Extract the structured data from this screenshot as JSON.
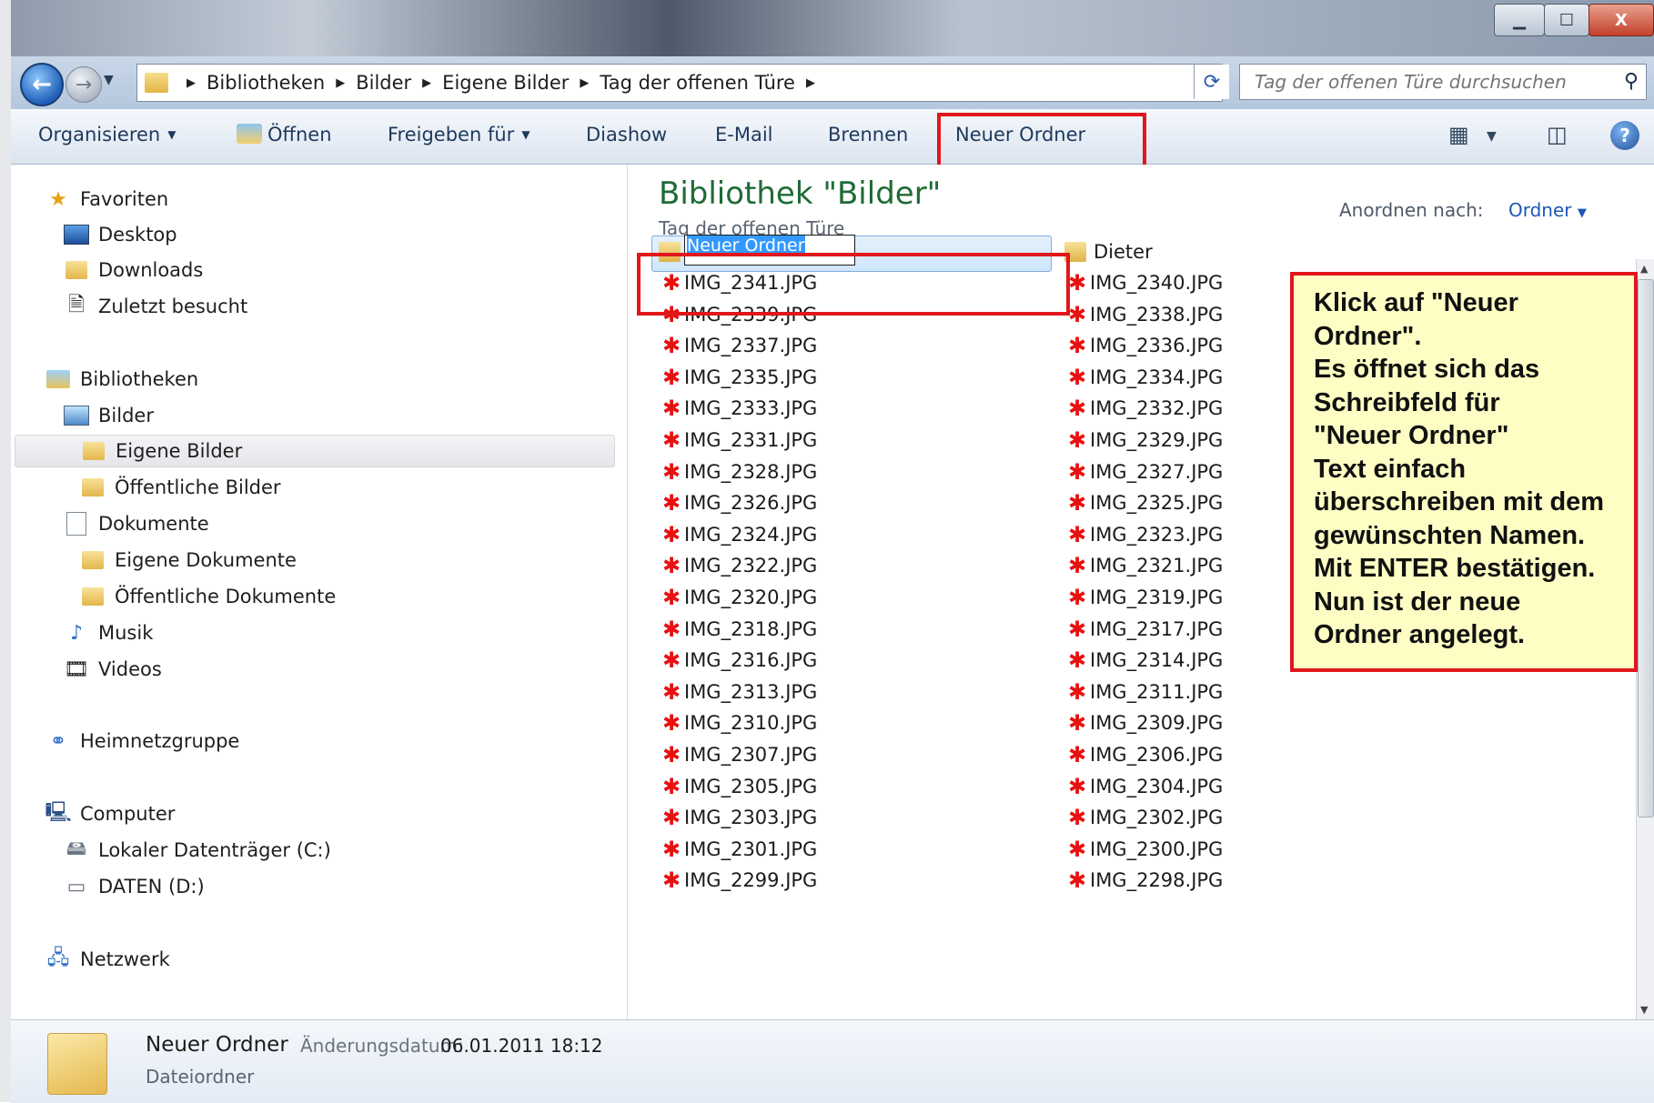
{
  "window": {
    "min_label": "▁",
    "max_label": "☐",
    "close_label": "X"
  },
  "address": {
    "crumbs": [
      "Bibliotheken",
      "Bilder",
      "Eigene Bilder",
      "Tag der offenen Türe"
    ],
    "search_placeholder": "Tag der offenen Türe durchsuchen"
  },
  "toolbar": {
    "organize": "Organisieren",
    "open": "Öffnen",
    "share": "Freigeben für",
    "slideshow": "Diashow",
    "email": "E-Mail",
    "burn": "Brennen",
    "new_folder": "Neuer Ordner"
  },
  "nav": {
    "favorites": "Favoriten",
    "desktop": "Desktop",
    "downloads": "Downloads",
    "recent": "Zuletzt besucht",
    "libraries": "Bibliotheken",
    "pictures": "Bilder",
    "my_pictures": "Eigene Bilder",
    "public_pictures": "Öffentliche Bilder",
    "documents": "Dokumente",
    "my_documents": "Eigene Dokumente",
    "public_documents": "Öffentliche Dokumente",
    "music": "Musik",
    "videos": "Videos",
    "homegroup": "Heimnetzgruppe",
    "computer": "Computer",
    "drive_c": "Lokaler Datenträger (C:)",
    "drive_d": "DATEN (D:)",
    "network": "Netzwerk"
  },
  "content": {
    "title": "Bibliothek \"Bilder\"",
    "subtitle": "Tag der offenen Türe",
    "arrange_label": "Anordnen nach:",
    "arrange_value": "Ordner",
    "rename_value": "Neuer Ordner",
    "folder_dieter": "Dieter",
    "col1": [
      "IMG_2341.JPG",
      "IMG_2339.JPG",
      "IMG_2337.JPG",
      "IMG_2335.JPG",
      "IMG_2333.JPG",
      "IMG_2331.JPG",
      "IMG_2328.JPG",
      "IMG_2326.JPG",
      "IMG_2324.JPG",
      "IMG_2322.JPG",
      "IMG_2320.JPG",
      "IMG_2318.JPG",
      "IMG_2316.JPG",
      "IMG_2313.JPG",
      "IMG_2310.JPG",
      "IMG_2307.JPG",
      "IMG_2305.JPG",
      "IMG_2303.JPG",
      "IMG_2301.JPG",
      "IMG_2299.JPG"
    ],
    "col2": [
      "IMG_2340.JPG",
      "IMG_2338.JPG",
      "IMG_2336.JPG",
      "IMG_2334.JPG",
      "IMG_2332.JPG",
      "IMG_2329.JPG",
      "IMG_2327.JPG",
      "IMG_2325.JPG",
      "IMG_2323.JPG",
      "IMG_2321.JPG",
      "IMG_2319.JPG",
      "IMG_2317.JPG",
      "IMG_2314.JPG",
      "IMG_2311.JPG",
      "IMG_2309.JPG",
      "IMG_2306.JPG",
      "IMG_2304.JPG",
      "IMG_2302.JPG",
      "IMG_2300.JPG",
      "IMG_2298.JPG"
    ]
  },
  "note": {
    "lines": [
      "Klick auf \"Neuer",
      "Ordner\".",
      "Es öffnet sich das",
      "Schreibfeld für",
      "\"Neuer Ordner\"",
      "Text einfach",
      "überschreiben mit dem",
      "gewünschten Namen.",
      "Mit ENTER bestätigen.",
      "Nun ist der neue",
      "Ordner angelegt."
    ]
  },
  "details": {
    "name": "Neuer Ordner",
    "date_label": "Änderungsdatum:",
    "date": "06.01.2011 18:12",
    "type": "Dateiordner"
  },
  "colors": {
    "highlight_red": "#e1171b",
    "note_yellow": "#fdfdc4",
    "title_green": "#1e6b35",
    "link_blue": "#1c58b4"
  }
}
